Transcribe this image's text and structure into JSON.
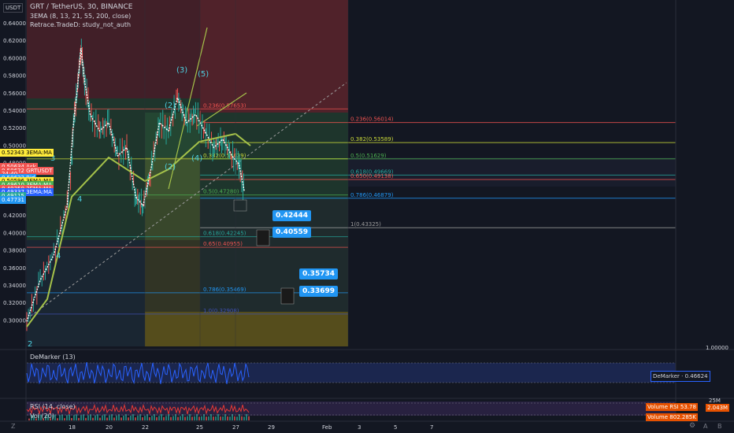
{
  "header": {
    "symbol_line": "GRT / TetherUS, 30, BINANCE",
    "indicator1": "3EMA (8, 13, 21, 55, 200, close)",
    "indicator2": "Retrace.TradeD: study_not_auth",
    "quote_label": "USDT"
  },
  "colors": {
    "background": "#131722",
    "up": "#26a69a",
    "down": "#ef5350",
    "ema_fast": "#ffffff",
    "ema_slow": "#a5c24a",
    "callout": "#2196f3",
    "demarker": "#2962ff",
    "rsi": "#e53935"
  },
  "chart_data": {
    "type": "line",
    "title": "GRT / TetherUS, 30, BINANCE",
    "price_axis_ticks": [
      "0.64000",
      "0.62000",
      "0.60000",
      "0.58000",
      "0.56000",
      "0.54000",
      "0.52000",
      "0.50000",
      "0.48000",
      "0.46000",
      "0.44000",
      "0.42000",
      "0.40000",
      "0.38000",
      "0.36000",
      "0.34000",
      "0.32000",
      "0.30000"
    ],
    "time_axis_ticks": [
      "18",
      "20",
      "22",
      "25",
      "27",
      "29",
      "Feb",
      "3",
      "5",
      "7"
    ],
    "ylim": [
      0.29,
      0.67
    ],
    "price_series": [
      {
        "t": 17.0,
        "p": 0.32
      },
      {
        "t": 17.3,
        "p": 0.37
      },
      {
        "t": 17.6,
        "p": 0.4
      },
      {
        "t": 17.9,
        "p": 0.46
      },
      {
        "t": 18.1,
        "p": 0.56
      },
      {
        "t": 18.3,
        "p": 0.6
      },
      {
        "t": 18.5,
        "p": 0.65
      },
      {
        "t": 18.7,
        "p": 0.61
      },
      {
        "t": 19.0,
        "p": 0.57
      },
      {
        "t": 19.5,
        "p": 0.55
      },
      {
        "t": 20.0,
        "p": 0.56
      },
      {
        "t": 20.5,
        "p": 0.52
      },
      {
        "t": 21.0,
        "p": 0.53
      },
      {
        "t": 21.5,
        "p": 0.47
      },
      {
        "t": 21.9,
        "p": 0.46
      },
      {
        "t": 22.3,
        "p": 0.5
      },
      {
        "t": 22.8,
        "p": 0.56
      },
      {
        "t": 23.3,
        "p": 0.55
      },
      {
        "t": 23.8,
        "p": 0.59
      },
      {
        "t": 24.3,
        "p": 0.56
      },
      {
        "t": 24.8,
        "p": 0.57
      },
      {
        "t": 25.3,
        "p": 0.55
      },
      {
        "t": 25.8,
        "p": 0.53
      },
      {
        "t": 26.3,
        "p": 0.54
      },
      {
        "t": 26.8,
        "p": 0.52
      },
      {
        "t": 27.2,
        "p": 0.51
      },
      {
        "t": 27.5,
        "p": 0.477
      }
    ],
    "price_tags": [
      {
        "value": "0.52343",
        "label": "3EMA:MA",
        "color": "#ffeb3b",
        "text": "#000000",
        "price": 0.5234
      },
      {
        "value": "0.50634",
        "label": "Ask",
        "color": "#ef5350",
        "text": "#ffffff",
        "price": 0.5063
      },
      {
        "value": "0.50622",
        "label": "GRTUSDT",
        "color": "#ef5350",
        "text": "#ffffff",
        "price": 0.5022
      },
      {
        "value": "24:40",
        "label": "",
        "color": "#ef5350",
        "text": "#ffffff",
        "price": 0.4978
      },
      {
        "value": "0.50622",
        "label": "Bid",
        "color": "#2196f3",
        "text": "#ffffff",
        "price": 0.4935
      },
      {
        "value": "0.50596",
        "label": "3EMA:MA",
        "color": "#ffeb3b",
        "text": "#000000",
        "price": 0.4891
      },
      {
        "value": "0.49610",
        "label": "3EMA:MA",
        "color": "#4caf50",
        "text": "#ffffff",
        "price": 0.4848
      },
      {
        "value": "0.49350",
        "label": "3EMA:MA",
        "color": "#ef5350",
        "text": "#ffffff",
        "price": 0.4804
      },
      {
        "value": "0.49337",
        "label": "3EMA:MA",
        "color": "#2962ff",
        "text": "#ffffff",
        "price": 0.476
      },
      {
        "value": "0.49115",
        "label": "",
        "color": "#26a69a",
        "text": "#ffffff",
        "price": 0.4716
      },
      {
        "value": "0.47731",
        "label": "",
        "color": "#2196f3",
        "text": "#ffffff",
        "price": 0.4672
      }
    ],
    "fib_levels_upper": [
      {
        "label": "0.236(0.56014)",
        "price": 0.56014,
        "color": "#ef5350"
      },
      {
        "label": "0.382(0.53589)",
        "price": 0.53589,
        "color": "#cddc39"
      },
      {
        "label": "0.5(0.51629)",
        "price": 0.51629,
        "color": "#4caf50"
      },
      {
        "label": "0.618(0.49669)",
        "price": 0.49669,
        "color": "#26a69a"
      },
      {
        "label": "0.650(0.49138)",
        "price": 0.49138,
        "color": "#ef5350"
      },
      {
        "label": "0.786(0.46879)",
        "price": 0.46879,
        "color": "#2196f3"
      },
      {
        "label": "1(0.43325)",
        "price": 0.43325,
        "color": "#9e9e9e"
      }
    ],
    "fib_levels_lower": [
      {
        "label": "0.236(0.57653)",
        "price": 0.5765,
        "color": "#ef5350"
      },
      {
        "label": "0.382(0.51629)",
        "price": 0.5163,
        "color": "#cddc39"
      },
      {
        "label": "0.5(0.47280)",
        "price": 0.4728,
        "color": "#4caf50"
      },
      {
        "label": "0.618(0.42245)",
        "price": 0.42245,
        "color": "#26a69a"
      },
      {
        "label": "0.65(0.40955)",
        "price": 0.40955,
        "color": "#ef5350"
      },
      {
        "label": "0.786(0.35469)",
        "price": 0.35469,
        "color": "#2196f3"
      },
      {
        "label": "1.0(0.32908)",
        "price": 0.32908,
        "color": "#3f51b5"
      }
    ],
    "targets": [
      {
        "value": "0.42444",
        "price": 0.42444
      },
      {
        "value": "0.40559",
        "price": 0.40559
      },
      {
        "value": "0.35734",
        "price": 0.35734
      },
      {
        "value": "0.33699",
        "price": 0.33699
      }
    ],
    "wave_labels": [
      "(3)",
      "(5)",
      "(2)",
      "(2)",
      "(4)",
      "3",
      "4",
      "4",
      "2"
    ],
    "demarker": {
      "label": "DeMarker (13)",
      "value": "0.46624",
      "axis": "1.00000"
    },
    "rsi": {
      "label": "RSI (14, close)",
      "value": "53.78",
      "value_label": "RSI",
      "axis": "25M"
    },
    "volume": {
      "label": "Vol (20)",
      "value": "2.043M",
      "value_label": "Volume",
      "ma_value": "802.285K",
      "ma_label": "Volume"
    }
  },
  "footer": {
    "left_icon": "Z",
    "right_icons": [
      "⚙",
      "A",
      "B"
    ]
  }
}
